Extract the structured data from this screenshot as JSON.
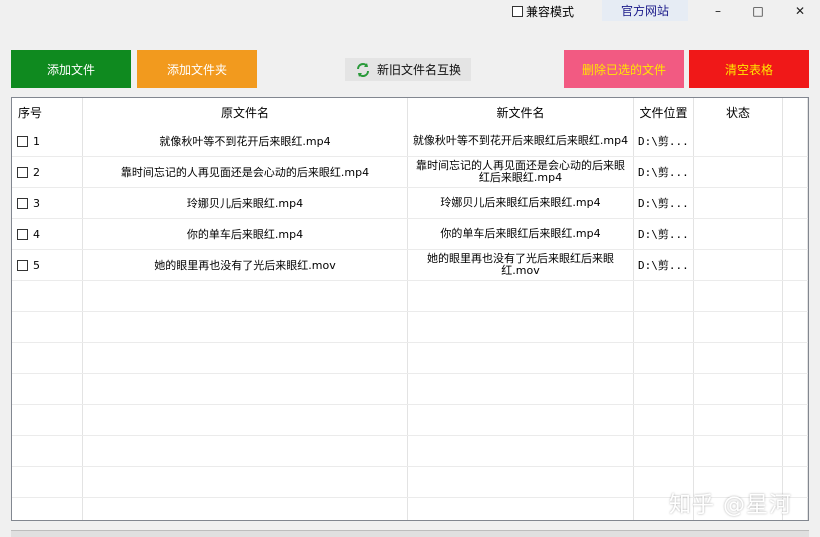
{
  "titlebar": {
    "compat_label": "兼容模式",
    "official_label": "官方网站",
    "minimize": "–",
    "maximize": "□",
    "close": "✕"
  },
  "toolbar": {
    "add_file": "添加文件",
    "add_folder": "添加文件夹",
    "swap_names": "新旧文件名互换",
    "delete_selected": "删除已选的文件",
    "clear_table": "清空表格"
  },
  "columns": [
    "序号",
    "原文件名",
    "新文件名",
    "文件位置",
    "状态"
  ],
  "rows": [
    {
      "seq": "1",
      "orig": "就像秋叶等不到花开后来眼红.mp4",
      "new": "就像秋叶等不到花开后来眼红后来眼红.mp4",
      "loc": "D:\\剪...",
      "status": ""
    },
    {
      "seq": "2",
      "orig": "靠时间忘记的人再见面还是会心动的后来眼红.mp4",
      "new": "靠时间忘记的人再见面还是会心动的后来眼红后来眼红.mp4",
      "loc": "D:\\剪...",
      "status": ""
    },
    {
      "seq": "3",
      "orig": "玲娜贝儿后来眼红.mp4",
      "new": "玲娜贝儿后来眼红后来眼红.mp4",
      "loc": "D:\\剪...",
      "status": ""
    },
    {
      "seq": "4",
      "orig": "你的单车后来眼红.mp4",
      "new": "你的单车后来眼红后来眼红.mp4",
      "loc": "D:\\剪...",
      "status": ""
    },
    {
      "seq": "5",
      "orig": "她的眼里再也没有了光后来眼红.mov",
      "new": "她的眼里再也没有了光后来眼红后来眼红.mov",
      "loc": "D:\\剪...",
      "status": ""
    }
  ],
  "watermark": "知乎 @星河"
}
